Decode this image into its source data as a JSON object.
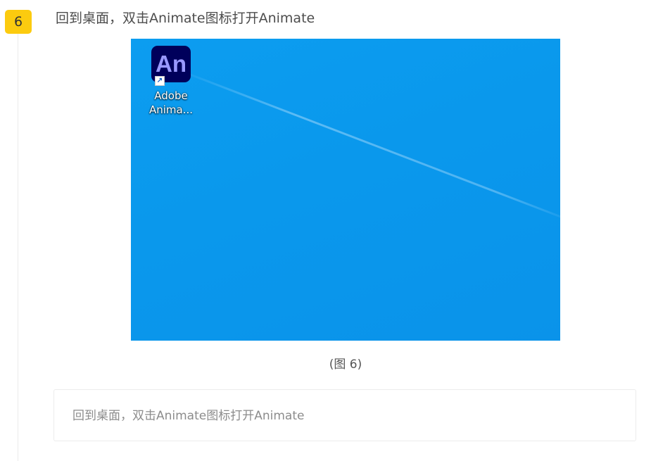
{
  "step": {
    "number": "6",
    "title": "回到桌面，双击Animate图标打开Animate"
  },
  "screenshot": {
    "desktop_icon": {
      "glyph": "An",
      "label_line1": "Adobe",
      "label_line2": "Anima...",
      "icon": "adobe-animate-icon",
      "shortcut_icon": "shortcut-arrow-icon",
      "tile_color": "#00005b",
      "glyph_color": "#9999ff"
    },
    "wallpaper_color": "#0a98ec"
  },
  "caption": "(图 6)",
  "note": "回到桌面，双击Animate图标打开Animate",
  "colors": {
    "badge": "#fccb0f",
    "title_text": "#4d4d4d",
    "note_text": "#8c8c8c"
  }
}
